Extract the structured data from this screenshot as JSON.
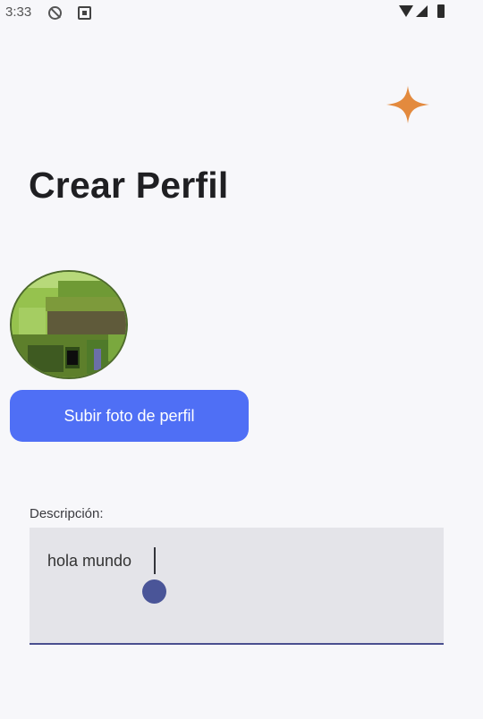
{
  "status_bar": {
    "time": "3:33",
    "icons": [
      "do-not-disturb-icon",
      "notification-icon",
      "wifi-icon",
      "signal-icon",
      "battery-icon"
    ]
  },
  "header": {
    "sparkle_icon": "sparkle-icon",
    "title": "Crear Perfil"
  },
  "profile": {
    "avatar_icon": "avatar-image",
    "upload_button_label": "Subir foto de perfil"
  },
  "description": {
    "label": "Descripción:",
    "value": "hola mundo"
  },
  "colors": {
    "accent": "#4f6ff5",
    "sparkle": "#e38a3e",
    "field_underline": "#4a4f8f",
    "cursor_handle": "#4a5598"
  }
}
